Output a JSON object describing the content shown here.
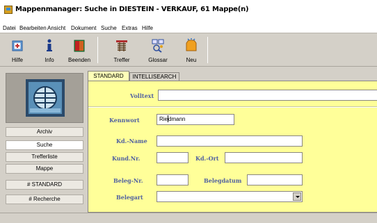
{
  "window": {
    "title": "Mappenmanager: Suche in DIESTEIN - VERKAUF, 61 Mappe(n)"
  },
  "menu": {
    "items": [
      "Datei",
      "Bearbeiten",
      "Ansicht",
      "Dokument",
      "Suche",
      "Extras",
      "Hilfe"
    ]
  },
  "toolbar": {
    "buttons": [
      {
        "label": "Hilfe",
        "icon": "help-book-icon"
      },
      {
        "label": "Info",
        "icon": "info-icon"
      },
      {
        "label": "Beenden",
        "icon": "exit-door-icon"
      },
      {
        "label": "Treffer",
        "icon": "hits-list-icon"
      },
      {
        "label": "Glossar",
        "icon": "glossary-icon"
      },
      {
        "label": "Neu",
        "icon": "new-icon"
      }
    ]
  },
  "sidebar": {
    "logo_icon": "app-logo-icon",
    "buttons": [
      "Archiv",
      "Suche",
      "Trefferliste",
      "Mappe",
      "# STANDARD",
      "# Recherche"
    ],
    "active": "Suche"
  },
  "tabs": [
    "STANDARD",
    "INTELLISEARCH"
  ],
  "active_tab": "STANDARD",
  "form": {
    "volltext_label": "Volltext",
    "volltext_value": "",
    "kennwort_label": "Kennwort",
    "kennwort_value_before_caret": "Rie",
    "kennwort_value_after_caret": "dmann",
    "kdname_label": "Kd.-Name",
    "kdname_value": "",
    "kundnr_label": "Kund.Nr.",
    "kundnr_value": "",
    "kdort_label": "Kd.-Ort",
    "kdort_value": "",
    "belegnr_label": "Beleg-Nr.",
    "belegnr_value": "",
    "belegdatum_label": "Belegdatum",
    "belegdatum_value": "",
    "belegart_label": "Belegart",
    "belegart_value": ""
  },
  "colors": {
    "panel_background": "#ffff99",
    "field_label": "#5060a0",
    "chrome": "#d4d0c8"
  }
}
